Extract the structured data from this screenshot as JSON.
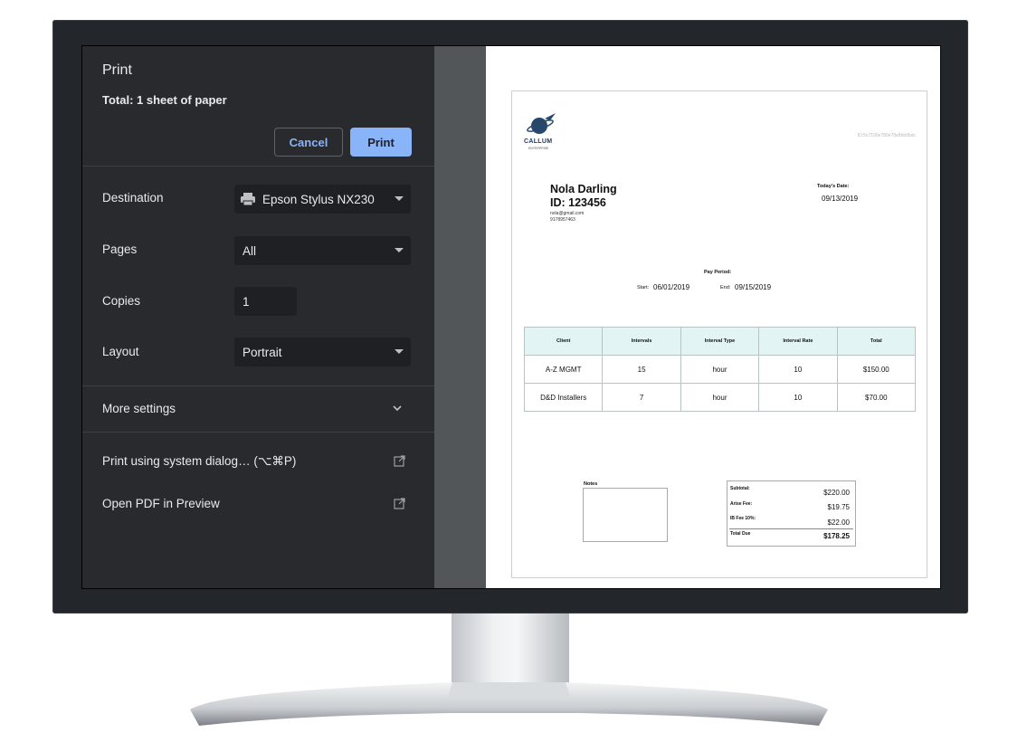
{
  "dialog": {
    "title": "Print",
    "summary": "Total: 1 sheet of paper",
    "cancel_label": "Cancel",
    "print_label": "Print",
    "destination": {
      "label": "Destination",
      "value": "Epson Stylus NX230",
      "icon": "printer-icon"
    },
    "pages": {
      "label": "Pages",
      "value": "All"
    },
    "copies": {
      "label": "Copies",
      "value": "1"
    },
    "layout": {
      "label": "Layout",
      "value": "Portrait"
    },
    "more_settings": "More settings",
    "system_dialog": "Print using system dialog… (⌥⌘P)",
    "open_pdf": "Open PDF in Preview",
    "colors": {
      "panel": "#292a2d",
      "accent": "#8ab4f8",
      "field": "#1f2023"
    }
  },
  "document": {
    "logo_text": "CALLUM",
    "logo_sub": "ENTERPRISE",
    "doc_id": "ID:5c7190e780e78e8bb9bdc",
    "employee": {
      "name": "Nola Darling",
      "id": "ID: 123456",
      "email": "nola@gmail.com",
      "phone": "9178957463"
    },
    "today_label": "Today's Date:",
    "today_value": "09/13/2019",
    "pay_period_label": "Pay Period:",
    "start_label": "Start:",
    "start_value": "06/01/2019",
    "end_label": "End:",
    "end_value": "09/15/2019",
    "table": {
      "headers": [
        "Client",
        "Intervals",
        "Interval Type",
        "Interval Rate",
        "Total"
      ],
      "rows": [
        [
          "A-Z MGMT",
          "15",
          "hour",
          "10",
          "$150.00"
        ],
        [
          "D&D Installers",
          "7",
          "hour",
          "10",
          "$70.00"
        ]
      ]
    },
    "notes_label": "Notes",
    "totals": {
      "subtotal_label": "Subtotal:",
      "subtotal_value": "$220.00",
      "arise_label": "Arise Fee:",
      "arise_value": "$19.75",
      "ib_label": "IB Fee 10%:",
      "ib_value": "$22.00",
      "due_label": "Total Due",
      "due_value": "$178.25"
    }
  }
}
